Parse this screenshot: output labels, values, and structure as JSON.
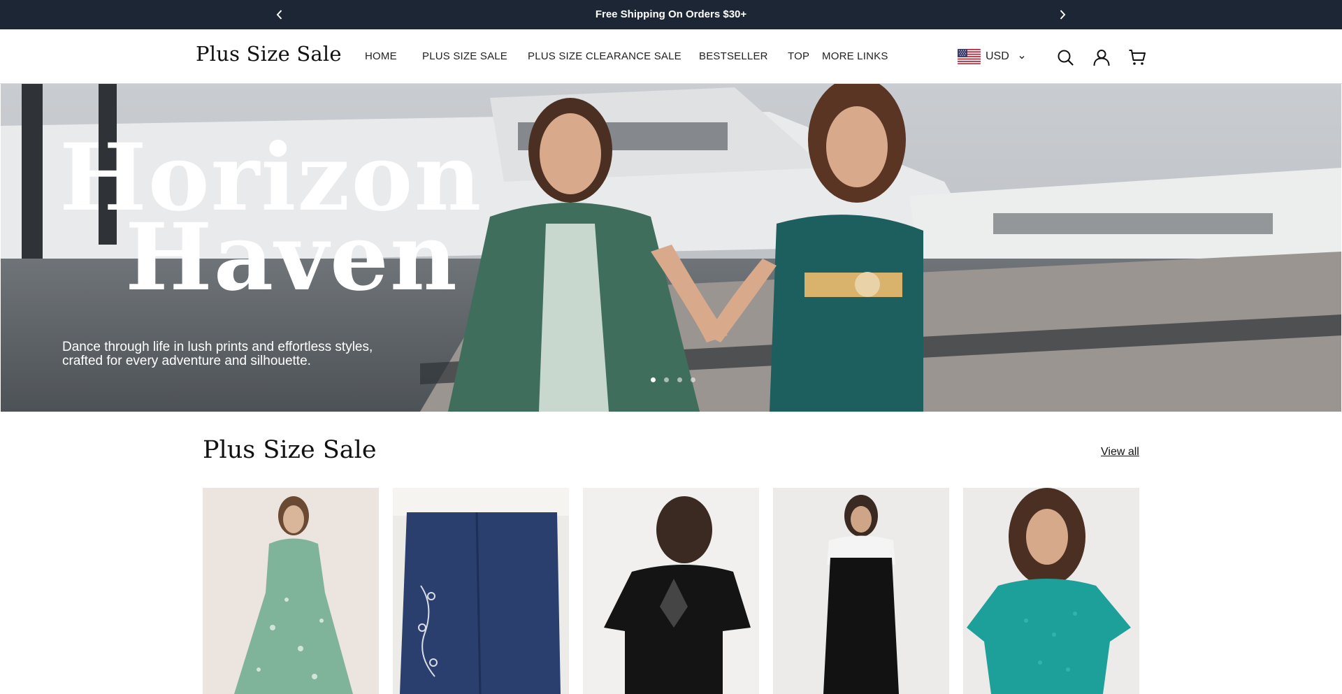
{
  "announcement": {
    "text": "Free Shipping On Orders $30+",
    "prev_icon": "chevron-left-icon",
    "next_icon": "chevron-right-icon"
  },
  "header": {
    "logo": "Plus Size Sale",
    "nav": [
      "HOME",
      "PLUS SIZE SALE",
      "PLUS SIZE CLEARANCE SALE",
      "BESTSELLER",
      "TOP",
      "MORE LINKS"
    ],
    "currency": "USD",
    "icons": [
      "search-icon",
      "account-icon",
      "cart-icon"
    ]
  },
  "hero": {
    "title_line1": "Horizon",
    "title_line2": "Haven",
    "subtitle_line1": "Dance through life in lush prints and effortless styles,",
    "subtitle_line2": "crafted for every adventure and silhouette.",
    "slides": 4,
    "active_slide": 1
  },
  "section": {
    "title": "Plus Size Sale",
    "view_all": "View all"
  },
  "products": [
    {
      "image": "green-floral-dress"
    },
    {
      "image": "embroidered-denim-jeans"
    },
    {
      "image": "black-butterfly-back-tee"
    },
    {
      "image": "black-overall-jumpsuit"
    },
    {
      "image": "teal-eyelet-top"
    }
  ],
  "colors": {
    "announce_bg": "#1c2634",
    "text": "#111111",
    "hero_text": "#ffffff"
  }
}
